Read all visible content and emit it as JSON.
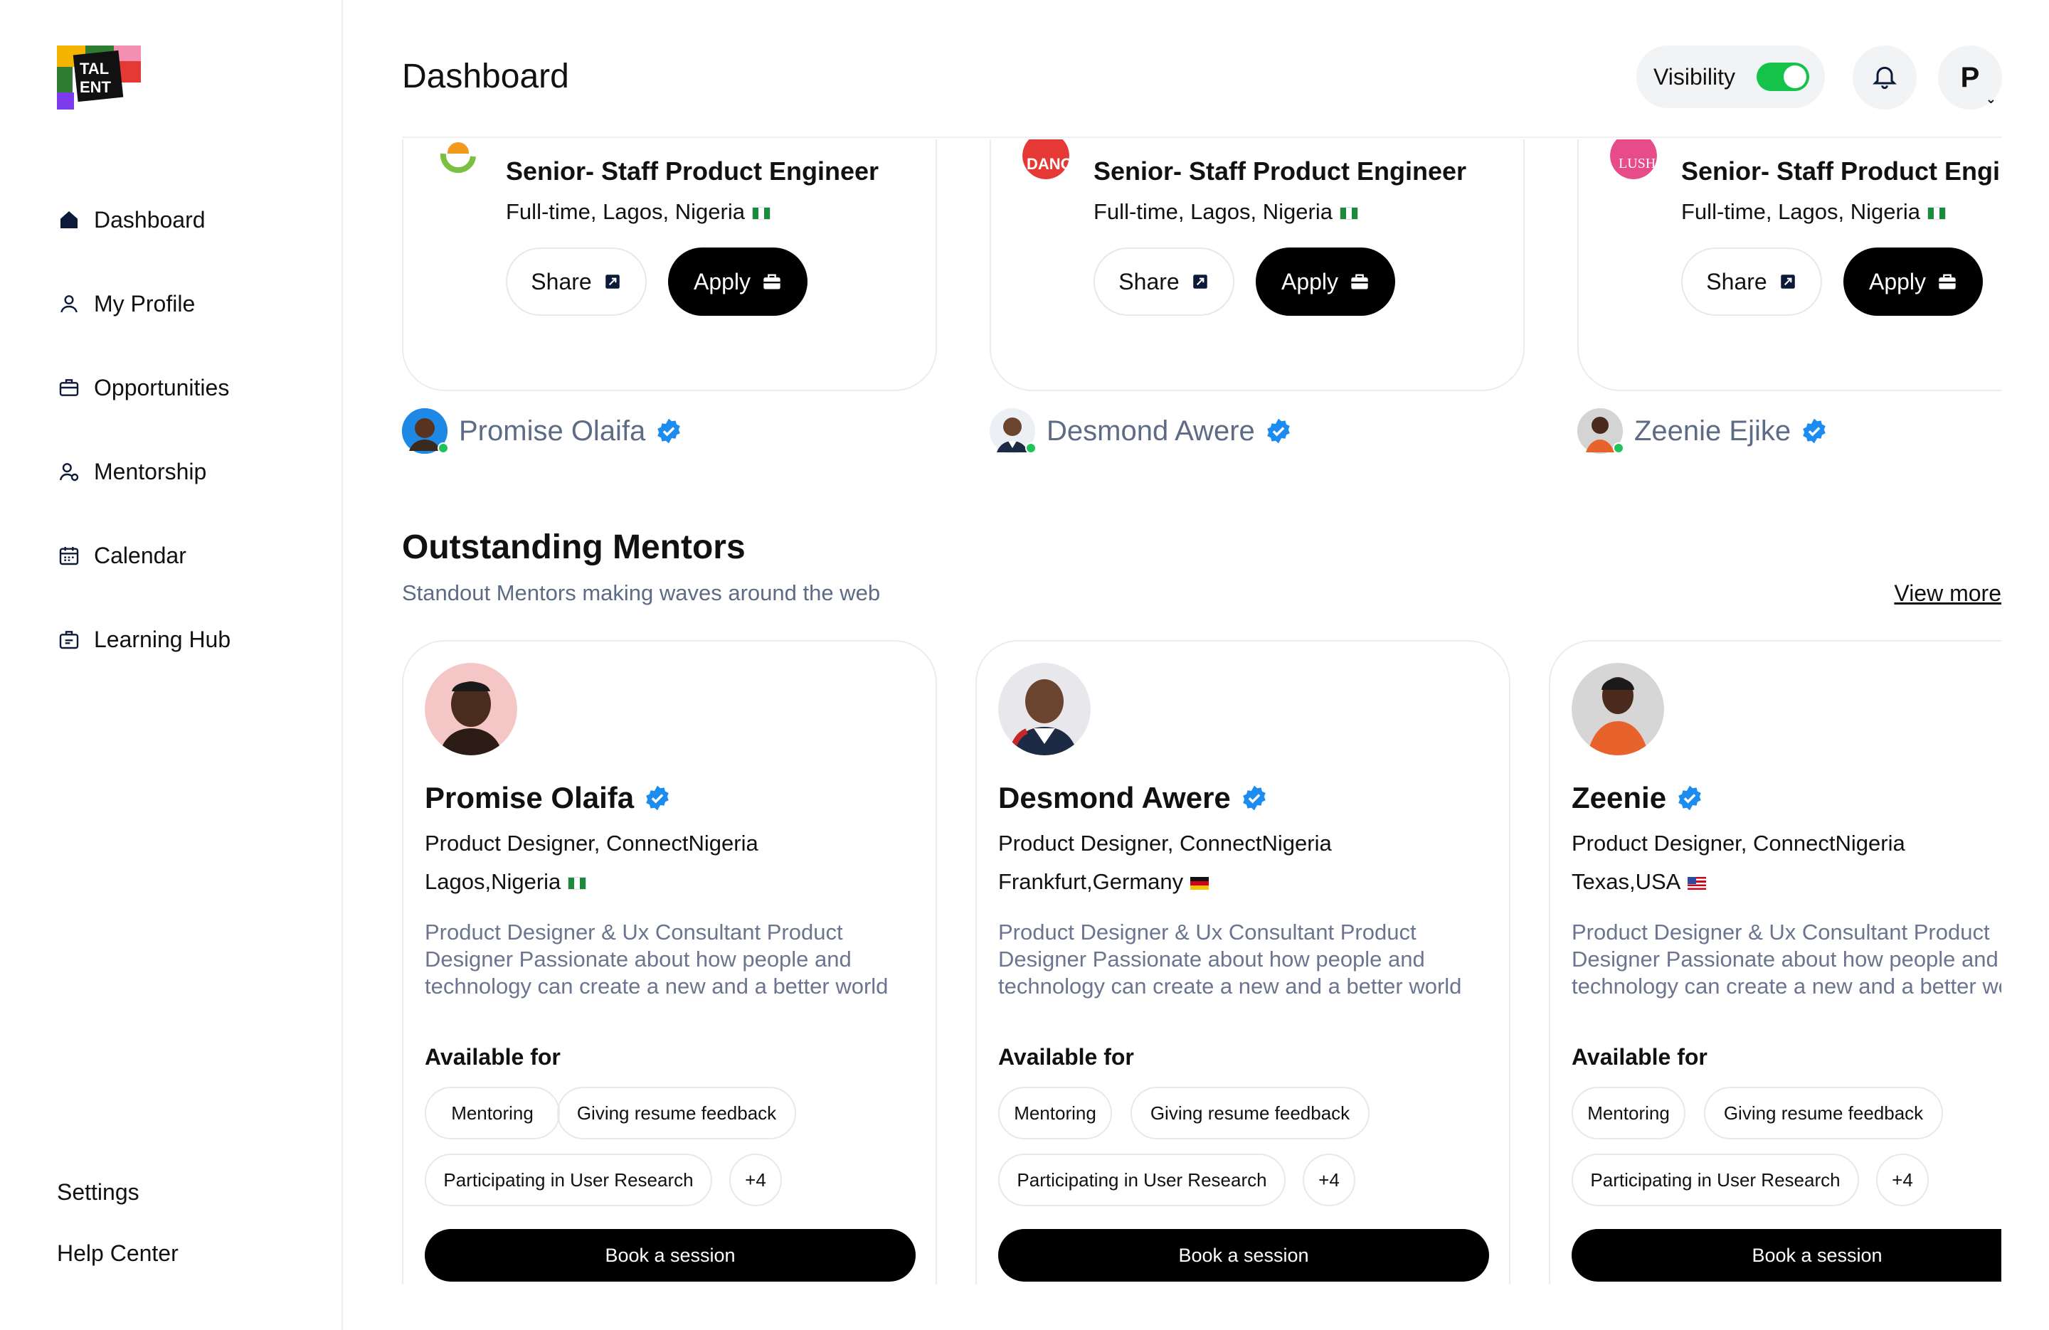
{
  "brand": {
    "logo_text": "TALENT"
  },
  "sidebar": {
    "items": [
      {
        "label": "Dashboard",
        "icon": "home-icon"
      },
      {
        "label": "My Profile",
        "icon": "user-icon"
      },
      {
        "label": "Opportunities",
        "icon": "briefcase-icon"
      },
      {
        "label": "Mentorship",
        "icon": "mentor-icon"
      },
      {
        "label": "Calendar",
        "icon": "calendar-icon"
      },
      {
        "label": "Learning Hub",
        "icon": "learning-icon"
      }
    ],
    "bottom": {
      "settings": "Settings",
      "help": "Help Center"
    }
  },
  "header": {
    "title": "Dashboard",
    "visibility_label": "Visibility",
    "visibility_on": true,
    "avatar_initial": "P"
  },
  "jobs": [
    {
      "title": "Senior- Staff Product Engineer",
      "subtitle": "Full-time, Lagos, Nigeria",
      "share": "Share",
      "apply": "Apply",
      "poster": "Promise Olaifa",
      "logo_color": "#7bc043"
    },
    {
      "title": "Senior- Staff Product Engineer",
      "subtitle": "Full-time, Lagos, Nigeria",
      "share": "Share",
      "apply": "Apply",
      "poster": "Desmond Awere",
      "logo_color": "#e53935"
    },
    {
      "title": "Senior- Staff Product Engineer",
      "subtitle": "Full-time, Lagos, Nigeria",
      "share": "Share",
      "apply": "Apply",
      "poster": "Zeenie Ejike",
      "logo_color": "#e84b8a"
    }
  ],
  "mentors_section": {
    "title": "Outstanding Mentors",
    "subtitle": "Standout Mentors making waves around the web",
    "view_more": "View more"
  },
  "mentors": [
    {
      "name": "Promise Olaifa",
      "role": "Product Designer, ConnectNigeria",
      "location": "Lagos,Nigeria",
      "flag": "ng",
      "bio": "Product Designer & Ux Consultant Product Designer Passionate about how people and technology can create a new and a better world",
      "available_label": "Available for",
      "chips": [
        "Mentoring",
        "Giving resume feedback",
        "Participating in User Research",
        "+4"
      ],
      "book": "Book a session",
      "avatar_bg": "#f5c6c6"
    },
    {
      "name": "Desmond Awere",
      "role": "Product Designer, ConnectNigeria",
      "location": "Frankfurt,Germany",
      "flag": "de",
      "bio": "Product Designer & Ux Consultant Product Designer Passionate about how people and technology can create a new and a better world",
      "available_label": "Available for",
      "chips": [
        "Mentoring",
        "Giving resume feedback",
        "Participating in User Research",
        "+4"
      ],
      "book": "Book a session",
      "avatar_bg": "#e8e8ec"
    },
    {
      "name": "Zeenie",
      "role": "Product Designer, ConnectNigeria",
      "location": "Texas,USA",
      "flag": "us",
      "bio": "Product Designer & Ux Consultant Product Designer Passionate about how people and technology can create a new and a better world",
      "available_label": "Available for",
      "chips": [
        "Mentoring",
        "Giving resume feedback",
        "Participating in User Research",
        "+4"
      ],
      "book": "Book a session",
      "avatar_bg": "#d9d9d9"
    }
  ]
}
